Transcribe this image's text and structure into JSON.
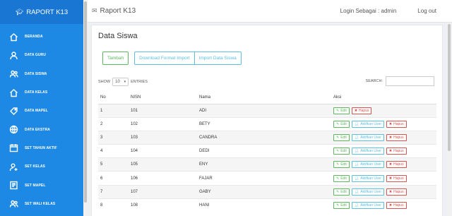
{
  "app": {
    "brand": "RAPORT K13",
    "header_title": "Raport K13"
  },
  "topbar": {
    "login_label": "Login Sebagai : admin",
    "logout_label": "Log out"
  },
  "sidebar": {
    "items": [
      {
        "label": "BERANDA",
        "icon": "home-icon"
      },
      {
        "label": "DATA GURU",
        "icon": "user-icon"
      },
      {
        "label": "DATA SISWA",
        "icon": "users-icon"
      },
      {
        "label": "DATA KELAS",
        "icon": "home-icon"
      },
      {
        "label": "DATA MAPEL",
        "icon": "tag-icon"
      },
      {
        "label": "DATA EKSTRA",
        "icon": "globe-icon"
      },
      {
        "label": "SET TAHUN AKTIF",
        "icon": "calendar-icon"
      },
      {
        "label": "SET KELAS",
        "icon": "user-plus-icon"
      },
      {
        "label": "SET MAPEL",
        "icon": "book-icon"
      },
      {
        "label": "SET WALI KELAS",
        "icon": "users-icon"
      }
    ]
  },
  "page": {
    "title": "Data Siswa",
    "buttons": {
      "tambah": "Tambah",
      "download": "Download Format Import",
      "import": "Import Data Siswa"
    },
    "show_label": "SHOW",
    "entries_value": "10",
    "entries_label": "ENTRIES",
    "search_label": "SEARCH:"
  },
  "table": {
    "headers": [
      "No",
      "NISN",
      "Nama",
      "Aksi"
    ],
    "edit_label": "Edit",
    "akun_label": "Aktifkan User",
    "hapus_label": "Hapus",
    "rows": [
      {
        "no": "1",
        "nisn": "101",
        "nama": "ADI",
        "akun": false
      },
      {
        "no": "2",
        "nisn": "102",
        "nama": "BETY",
        "akun": true
      },
      {
        "no": "3",
        "nisn": "103",
        "nama": "CANDRA",
        "akun": true
      },
      {
        "no": "4",
        "nisn": "104",
        "nama": "DEDI",
        "akun": true
      },
      {
        "no": "5",
        "nisn": "105",
        "nama": "ENY",
        "akun": true
      },
      {
        "no": "6",
        "nisn": "106",
        "nama": "FAJAR",
        "akun": true
      },
      {
        "no": "7",
        "nisn": "107",
        "nama": "GABY",
        "akun": true
      },
      {
        "no": "8",
        "nisn": "108",
        "nama": "HANI",
        "akun": true
      }
    ]
  }
}
